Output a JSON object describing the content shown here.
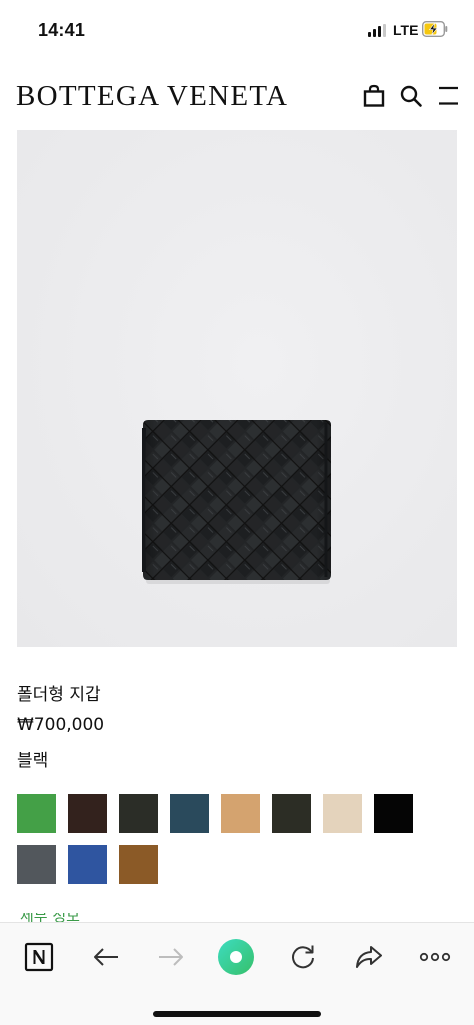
{
  "status_bar": {
    "time": "14:41",
    "network": "LTE"
  },
  "header": {
    "brand": "BOTTEGA VENETA"
  },
  "product": {
    "name": "폴더형 지갑",
    "price": "₩700,000",
    "color": "블랙"
  },
  "swatches": [
    {
      "color": "#44a047"
    },
    {
      "color": "#33221d"
    },
    {
      "color": "#2b2d27"
    },
    {
      "color": "#2a4a5c"
    },
    {
      "color": "#d4a36f"
    },
    {
      "color": "#2c2d25"
    },
    {
      "color": "#e4d3bc"
    },
    {
      "color": "#050505"
    },
    {
      "color": "#52575c"
    },
    {
      "color": "#2f55a0"
    },
    {
      "color": "#8b5a27"
    }
  ],
  "more_link": "세부 정보",
  "colors": {
    "accent_green": "#3fd38d",
    "link_green": "#3a9a48"
  }
}
